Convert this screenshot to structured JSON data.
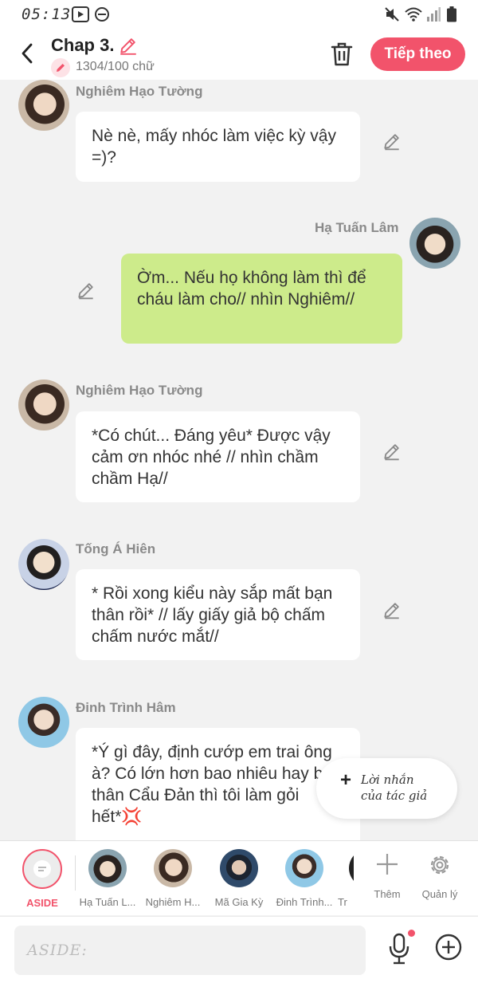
{
  "status_bar": {
    "time": "05:13"
  },
  "header": {
    "title": "Chap 3.",
    "word_count": "1304/100 chữ",
    "next_label": "Tiếp theo"
  },
  "messages": [
    {
      "speaker": "Nghiêm Hạo Tường",
      "text": "Nè nè, mấy nhóc làm việc kỳ vậy =)?"
    },
    {
      "speaker": "Hạ Tuấn Lâm",
      "text": "Ờm... Nếu họ không làm thì để cháu làm cho// nhìn Nghiêm//"
    },
    {
      "speaker": "Nghiêm Hạo Tường",
      "text": "*Có chút... Đáng yêu* Được vậy cảm ơn nhóc nhé // nhìn chầm chầm Hạ//"
    },
    {
      "speaker": "Tống Á Hiên",
      "text": "* Rồi xong kiểu này sắp mất bạn thân rồi* // lấy giấy giả bộ chấm chấm nước mắt//"
    },
    {
      "speaker": "Đinh Trình Hâm",
      "text": "*Ý gì đây, định cướp em trai ông à? Có lớn hơn bao nhiêu hay bạn thân Cẩu Đản thì tôi làm gỏi hết*💢"
    }
  ],
  "author_note": {
    "line1": "Lời nhắn",
    "line2": "của tác giả"
  },
  "character_bar": {
    "aside_label": "ASIDE",
    "characters": [
      "Hạ Tuấn L...",
      "Nghiêm H...",
      "Mã Gia Kỳ",
      "Đinh Trình...",
      "Tr"
    ],
    "add_label": "Thêm",
    "manage_label": "Quản lý"
  },
  "input": {
    "placeholder": "ASIDE:"
  },
  "colors": {
    "accent": "#f2536b",
    "green_bubble": "#cdeb8b",
    "background": "#f2f2f2"
  }
}
